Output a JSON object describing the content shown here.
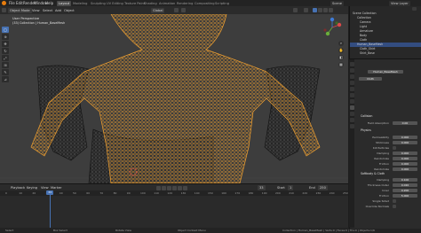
{
  "topbar": {
    "menus": [
      "File",
      "Edit",
      "Render",
      "Window",
      "Help"
    ],
    "workspaces": [
      "Layout",
      "Modeling",
      "Sculpting",
      "UV Editing",
      "Texture Paint",
      "Shading",
      "Animation",
      "Rendering",
      "Compositing",
      "Scripting"
    ],
    "active_workspace": "Layout",
    "scene": "Scene",
    "view_layer": "View Layer"
  },
  "viewport_header": {
    "mode": "Object Mode",
    "menus": [
      "View",
      "Select",
      "Add",
      "Object"
    ],
    "transform": "Global",
    "info_line1": "User Perspective",
    "info_line2": "(33) Collection | Human_BaseMesh"
  },
  "toolbar": {
    "tools": [
      "select-icon",
      "cursor-icon",
      "move-icon",
      "rotate-icon",
      "scale-icon",
      "transform-icon",
      "annotate-icon",
      "measure-icon"
    ]
  },
  "gizmo": {
    "x": "X",
    "y": "Y",
    "z": "Z"
  },
  "timeline": {
    "menus": [
      "Playback",
      "Keying",
      "View",
      "Marker"
    ],
    "current_frame": "33",
    "start_label": "Start",
    "start": "1",
    "end_label": "End",
    "end": "250",
    "ticks": [
      "0",
      "10",
      "20",
      "30",
      "40",
      "50",
      "60",
      "70",
      "80",
      "90",
      "100",
      "110",
      "120",
      "130",
      "140",
      "150",
      "160",
      "170",
      "180",
      "190",
      "200",
      "210",
      "220",
      "230",
      "240",
      "250"
    ]
  },
  "status": {
    "left1": "Select",
    "left2": "Box Select",
    "left3": "Rotate View",
    "left4": "Object Context Menu",
    "right": "Collection | Human_BaseMesh | Verts:0 | Faces:0 | Tris:0 | Objects:1/6"
  },
  "outliner": {
    "rows": [
      {
        "label": "Scene Collection",
        "sel": false
      },
      {
        "label": "Collection",
        "sel": false
      },
      {
        "label": "Camera",
        "sel": false
      },
      {
        "label": "Light",
        "sel": false
      },
      {
        "label": "Armature",
        "sel": false
      },
      {
        "label": "Body",
        "sel": false
      },
      {
        "label": "Cloth",
        "sel": false
      },
      {
        "label": "Human_BaseMesh",
        "sel": true
      },
      {
        "label": "Cloth_Shirt",
        "sel": false
      },
      {
        "label": "Shirt_Base",
        "sel": false
      }
    ]
  },
  "properties": {
    "object_name": "Human_BaseMesh",
    "modifier_name": "Cloth",
    "sections": {
      "collision": "Collision",
      "physics": "Physics",
      "softbody": "Softbody & Cloth"
    },
    "fields": [
      {
        "label": "Field Absorption",
        "value": "0.00"
      },
      {
        "label": "Permeability",
        "value": "0.000"
      },
      {
        "label": "Stickiness",
        "value": "0.000"
      },
      {
        "label": "Kill Particles",
        "value": ""
      },
      {
        "label": "Damping",
        "value": "0.000"
      },
      {
        "label": "Randomize",
        "value": "0.000"
      },
      {
        "label": "Friction",
        "value": "0.000"
      },
      {
        "label": "Randomize",
        "value": "0.000"
      },
      {
        "label": "Damping",
        "value": "0.100"
      },
      {
        "label": "Thickness Outer",
        "value": "0.020"
      },
      {
        "label": "Inner",
        "value": "0.200"
      },
      {
        "label": "Friction",
        "value": "5.000"
      },
      {
        "label": "Single Sided",
        "value": ""
      },
      {
        "label": "Override Normals",
        "value": ""
      }
    ]
  },
  "colors": {
    "accent": "#4772b3",
    "wire_selected": "#f0a030",
    "wire_dark": "#141414",
    "viewport_bg": "#3d3d3d"
  }
}
